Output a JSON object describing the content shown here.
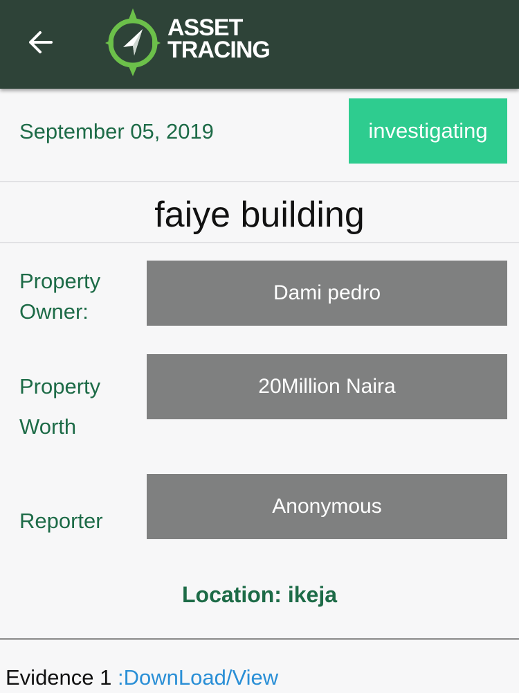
{
  "header": {
    "back_icon": "arrow-left-icon",
    "logo_icon": "compass-icon",
    "logo_line1": "ASSET",
    "logo_line2": "TRACING",
    "colors": {
      "bar": "#2e4338",
      "logo_ring": "#6cc04a"
    }
  },
  "case": {
    "date": "September 05, 2019",
    "status": "investigating",
    "title": "faiye building"
  },
  "fields": {
    "owner_label_line1": "Property",
    "owner_label_line2": "Owner:",
    "owner_value": "Dami pedro",
    "worth_label_line1": "Property",
    "worth_label_line2": "Worth",
    "worth_value": "20Million Naira",
    "reporter_label": "Reporter",
    "reporter_value": "Anonymous"
  },
  "location": {
    "text": "Location: ikeja"
  },
  "evidence": {
    "label": "Evidence 1",
    "link": ":DownLoad/View"
  },
  "colors": {
    "accent_green": "#1d6b47",
    "status_badge": "#2ecc8f",
    "value_box": "#7f8080",
    "link": "#2a8fd6"
  }
}
